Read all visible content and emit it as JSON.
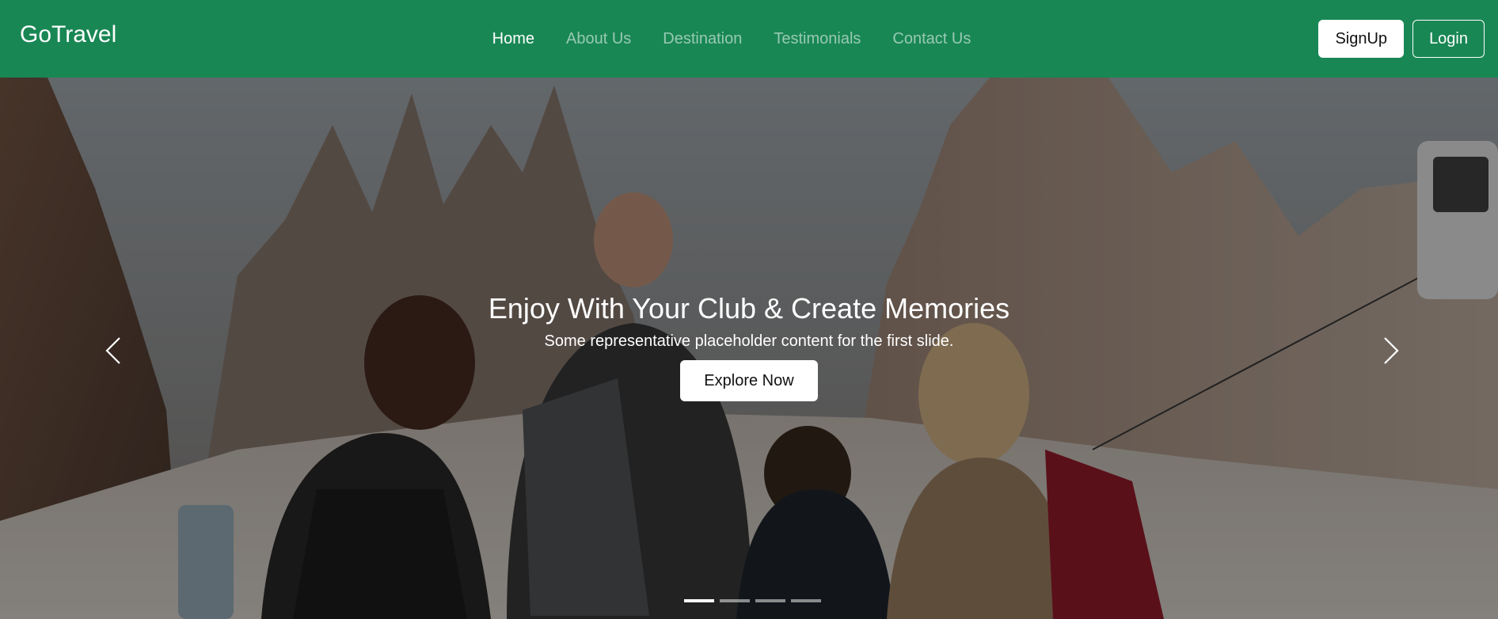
{
  "colors": {
    "navbar": "#198754",
    "accent": "#ffffff"
  },
  "navbar": {
    "brand": "GoTravel",
    "links": [
      {
        "label": "Home",
        "active": true
      },
      {
        "label": "About Us",
        "active": false
      },
      {
        "label": "Destination",
        "active": false
      },
      {
        "label": "Testimonials",
        "active": false
      },
      {
        "label": "Contact Us",
        "active": false
      }
    ],
    "signup_label": "SignUp",
    "login_label": "Login"
  },
  "carousel": {
    "title": "Enjoy With Your Club & Create Memories",
    "subtitle": "Some representative placeholder content for the first slide.",
    "button_label": "Explore Now",
    "prev_icon": "chevron-left-icon",
    "next_icon": "chevron-right-icon",
    "slide_count": 4,
    "active_slide": 1
  }
}
